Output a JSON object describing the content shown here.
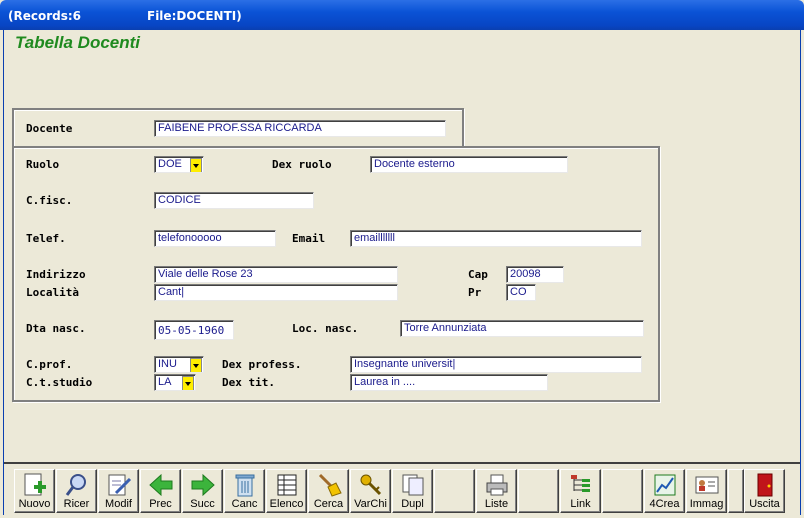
{
  "window": {
    "records_label": "(Records:6",
    "file_label": "File:DOCENTI)"
  },
  "form": {
    "title": "Tabella Docenti"
  },
  "fields": {
    "docente": {
      "label": "Docente",
      "value": "FAIBENE PROF.SSA RICCARDA"
    },
    "ruolo": {
      "label": "Ruolo",
      "value": "DOE"
    },
    "dex_ruolo": {
      "label": "Dex ruolo",
      "value": "Docente esterno"
    },
    "cfisc": {
      "label": "C.fisc.",
      "value": "CODICE"
    },
    "telef": {
      "label": "Telef.",
      "value": "telefonooooo"
    },
    "email": {
      "label": "Email",
      "value": "emailllllll"
    },
    "indirizzo": {
      "label": "Indirizzo",
      "value": "Viale delle Rose 23"
    },
    "cap": {
      "label": "Cap",
      "value": "20098"
    },
    "localita": {
      "label": "Località",
      "value": "Cant|"
    },
    "pr": {
      "label": "Pr",
      "value": "CO"
    },
    "dta_nasc": {
      "label": "Dta nasc.",
      "value": "05-05-1960"
    },
    "loc_nasc": {
      "label": "Loc. nasc.",
      "value": "Torre Annunziata"
    },
    "cprof": {
      "label": "C.prof.",
      "value": "INU"
    },
    "dex_profess": {
      "label": "Dex profess.",
      "value": "Insegnante universit|"
    },
    "ctstudio": {
      "label": "C.t.studio",
      "value": "LA"
    },
    "dex_tit": {
      "label": "Dex tit.",
      "value": "Laurea in ...."
    }
  },
  "toolbar": {
    "buttons": [
      {
        "label": "Nuovo",
        "icon": "new-icon"
      },
      {
        "label": "Ricer",
        "icon": "search-icon"
      },
      {
        "label": "Modif",
        "icon": "edit-icon"
      },
      {
        "label": "Prec",
        "icon": "arrow-left-icon"
      },
      {
        "label": "Succ",
        "icon": "arrow-right-icon"
      },
      {
        "label": "Canc",
        "icon": "trash-icon"
      },
      {
        "label": "Elenco",
        "icon": "list-icon"
      },
      {
        "label": "Cerca",
        "icon": "broom-icon"
      },
      {
        "label": "VarChi",
        "icon": "keys-icon"
      },
      {
        "label": "Dupl",
        "icon": "copy-icon"
      },
      {
        "label": "",
        "icon": ""
      },
      {
        "label": "Liste",
        "icon": "printer-icon"
      },
      {
        "label": "",
        "icon": ""
      },
      {
        "label": "Link",
        "icon": "tree-icon"
      },
      {
        "label": "",
        "icon": ""
      },
      {
        "label": "4Crea",
        "icon": "chart-icon"
      },
      {
        "label": "Immag",
        "icon": "id-card-icon"
      },
      {
        "label": "",
        "icon": ""
      },
      {
        "label": "Uscita",
        "icon": "door-icon"
      }
    ]
  },
  "colors": {
    "title_green": "#1f8a1f",
    "field_text": "#1a1a8c",
    "dropdown_yellow": "#ffee00"
  }
}
